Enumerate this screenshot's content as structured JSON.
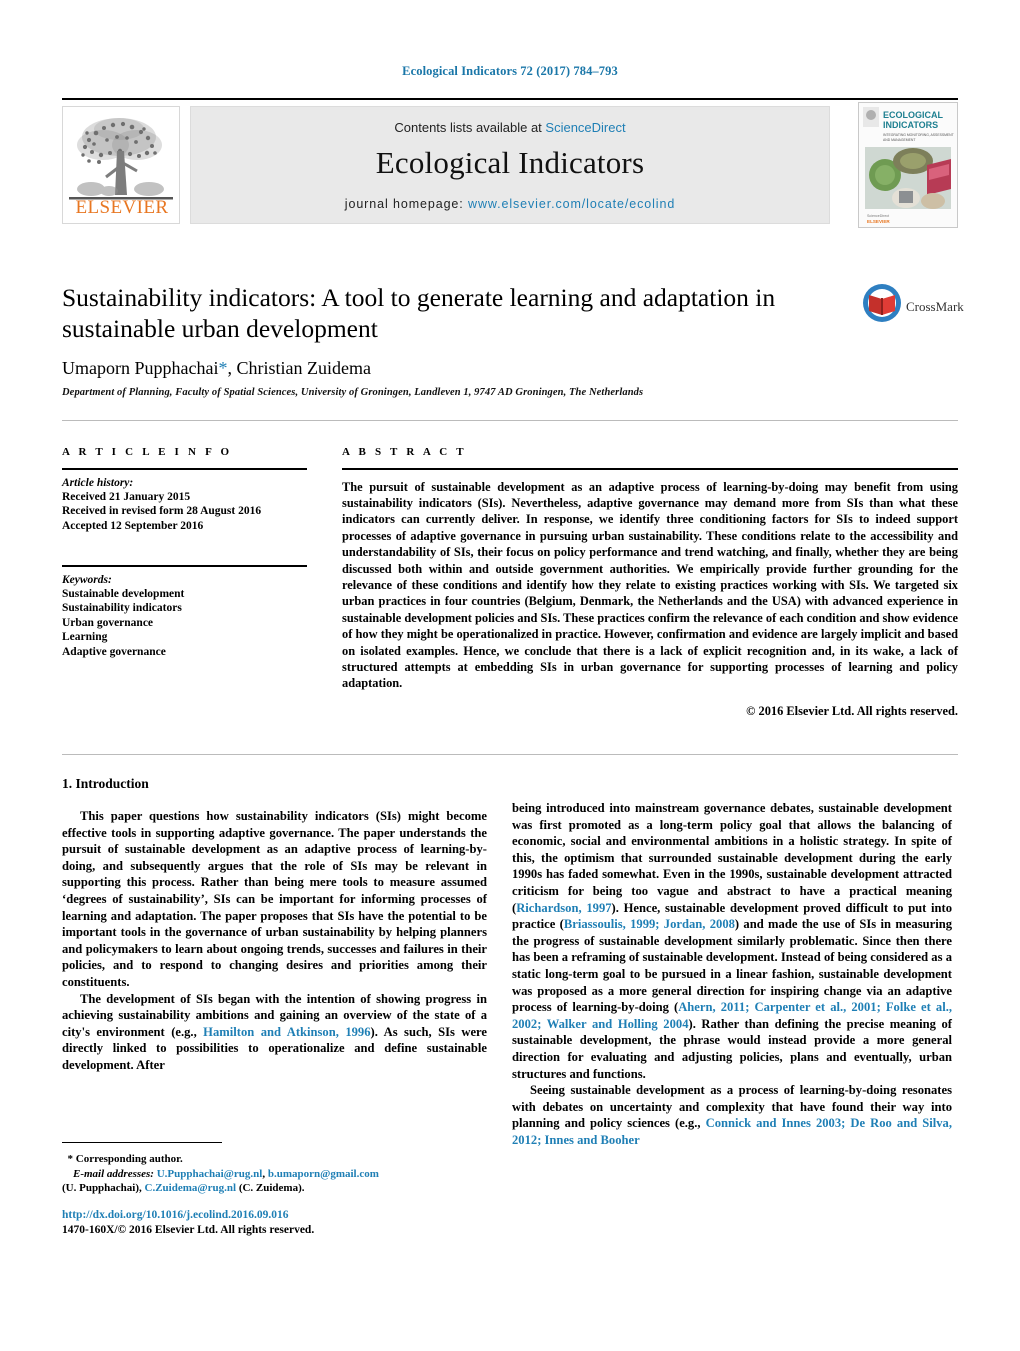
{
  "running_head": "Ecological Indicators 72 (2017) 784–793",
  "masthead": {
    "contents_prefix": "Contents lists available at ",
    "sciencedirect": "ScienceDirect",
    "journal_name": "Ecological Indicators",
    "homepage_prefix": "journal homepage: ",
    "homepage_url": "www.elsevier.com/locate/ecolind",
    "publisher_logo_text": "ELSEVIER",
    "cover_title_line1": "ECOLOGICAL",
    "cover_title_line2": "INDICATORS",
    "cover_subtitle": "INTEGRATING MONITORING, ASSESSMENT AND MANAGEMENT",
    "cover_footer": "ScienceDirect",
    "cover_footer2": "ELSEVIER"
  },
  "title": "Sustainability indicators: A tool to generate learning and adaptation in sustainable urban development",
  "authors": {
    "name1": "Umaporn Pupphachai",
    "star": "*",
    "separator": ", ",
    "name2": "Christian Zuidema"
  },
  "affiliation": "Department of Planning, Faculty of Spatial Sciences, University of Groningen, Landleven 1, 9747 AD Groningen, The Netherlands",
  "crossmark": {
    "label": "CrossMark"
  },
  "article_info": {
    "heading": "A R T I C L E     I N F O",
    "history_label": "Article history:",
    "history": [
      "Received 21 January 2015",
      "Received in revised form 28 August 2016",
      "Accepted 12 September 2016"
    ],
    "keywords_label": "Keywords:",
    "keywords": [
      "Sustainable development",
      "Sustainability indicators",
      "Urban governance",
      "Learning",
      "Adaptive governance"
    ]
  },
  "abstract": {
    "heading": "A B S T R A C T",
    "text": "The pursuit of sustainable development as an adaptive process of learning-by-doing may benefit from using sustainability indicators (SIs). Nevertheless, adaptive governance may demand more from SIs than what these indicators can currently deliver. In response, we identify three conditioning factors for SIs to indeed support processes of adaptive governance in pursuing urban sustainability. These conditions relate to the accessibility and understandability of SIs, their focus on policy performance and trend watching, and finally, whether they are being discussed both within and outside government authorities. We empirically provide further grounding for the relevance of these conditions and identify how they relate to existing practices working with SIs. We targeted six urban practices in four countries (Belgium, Denmark, the Netherlands and the USA) with advanced experience in sustainable development policies and SIs. These practices confirm the relevance of each condition and show evidence of how they might be operationalized in practice. However, confirmation and evidence are largely implicit and based on isolated examples. Hence, we conclude that there is a lack of explicit recognition and, in its wake, a lack of structured attempts at embedding SIs in urban governance for supporting processes of learning and policy adaptation.",
    "copyright": "© 2016 Elsevier Ltd. All rights reserved."
  },
  "body": {
    "section_heading": "1.  Introduction",
    "left_paragraphs": [
      {
        "parts": [
          {
            "t": "This paper questions how sustainability indicators (SIs) might become effective tools in supporting adaptive governance. The paper understands the pursuit of sustainable development as an adaptive process of learning-by-doing, and subsequently argues that the role of SIs may be relevant in supporting this process. Rather than being mere tools to measure assumed ‘degrees of sustainability’, SIs can be important for informing processes of learning and adaptation. The paper proposes that SIs have the potential to be important tools in the governance of urban sustainability by helping planners and policymakers to learn about ongoing trends, successes and failures in their policies, and to respond to changing desires and priorities among their constituents.",
            "link": false
          }
        ]
      },
      {
        "parts": [
          {
            "t": "The development of SIs began with the intention of showing progress in achieving sustainability ambitions and gaining an overview of the state of a city's environment (e.g., ",
            "link": false
          },
          {
            "t": "Hamilton and Atkinson, 1996",
            "link": true
          },
          {
            "t": "). As such, SIs were directly linked to possibilities to operationalize and define sustainable development. After",
            "link": false
          }
        ]
      }
    ],
    "right_paragraphs": [
      {
        "parts": [
          {
            "t": "being introduced into mainstream governance debates, sustainable development was first promoted as a long-term policy goal that allows the balancing of economic, social and environmental ambitions in a holistic strategy. In spite of this, the optimism that surrounded sustainable development during the early 1990s has faded somewhat. Even in the 1990s, sustainable development attracted criticism for being too vague and abstract to have a practical meaning (",
            "link": false
          },
          {
            "t": "Richardson, 1997",
            "link": true
          },
          {
            "t": "). Hence, sustainable development proved difficult to put into practice (",
            "link": false
          },
          {
            "t": "Briassoulis, 1999; Jordan, 2008",
            "link": true
          },
          {
            "t": ") and made the use of SIs in measuring the progress of sustainable development similarly problematic. Since then there has been a reframing of sustainable development. Instead of being considered as a static long-term goal to be pursued in a linear fashion, sustainable development was proposed as a more general direction for inspiring change via an adaptive process of learning-by-doing (",
            "link": false
          },
          {
            "t": "Ahern, 2011; Carpenter et al., 2001; Folke et al., 2002; Walker and Holling 2004",
            "link": true
          },
          {
            "t": "). Rather than defining the precise meaning of sustainable development, the phrase would instead provide a more general direction for evaluating and adjusting policies, plans and eventually, urban structures and functions.",
            "link": false
          }
        ]
      },
      {
        "parts": [
          {
            "t": "Seeing sustainable development as a process of learning-by-doing resonates with debates on uncertainty and complexity that have found their way into planning and policy sciences (e.g., ",
            "link": false
          },
          {
            "t": "Connick and Innes 2003; De Roo and Silva, 2012; Innes and Booher",
            "link": true
          }
        ]
      }
    ]
  },
  "footnote": {
    "corresponding_marker": "*",
    "corresponding_label": "Corresponding author.",
    "email_label": "E-mail addresses:",
    "email1": "U.Pupphachai@rug.nl",
    "email_sep1": ", ",
    "email2": "b.umaporn@gmail.com",
    "affil1": "(U. Pupphachai), ",
    "email3": "C.Zuidema@rug.nl",
    "affil2": " (C. Zuidema)."
  },
  "doi_block": {
    "doi": "http://dx.doi.org/10.1016/j.ecolind.2016.09.016",
    "issn_line": "1470-160X/© 2016 Elsevier Ltd. All rights reserved."
  },
  "colors": {
    "link": "#1f7fb5",
    "running_head": "#1976a8",
    "elsevier_orange": "#E87722",
    "masthead_bg": "#e9e9e9"
  }
}
